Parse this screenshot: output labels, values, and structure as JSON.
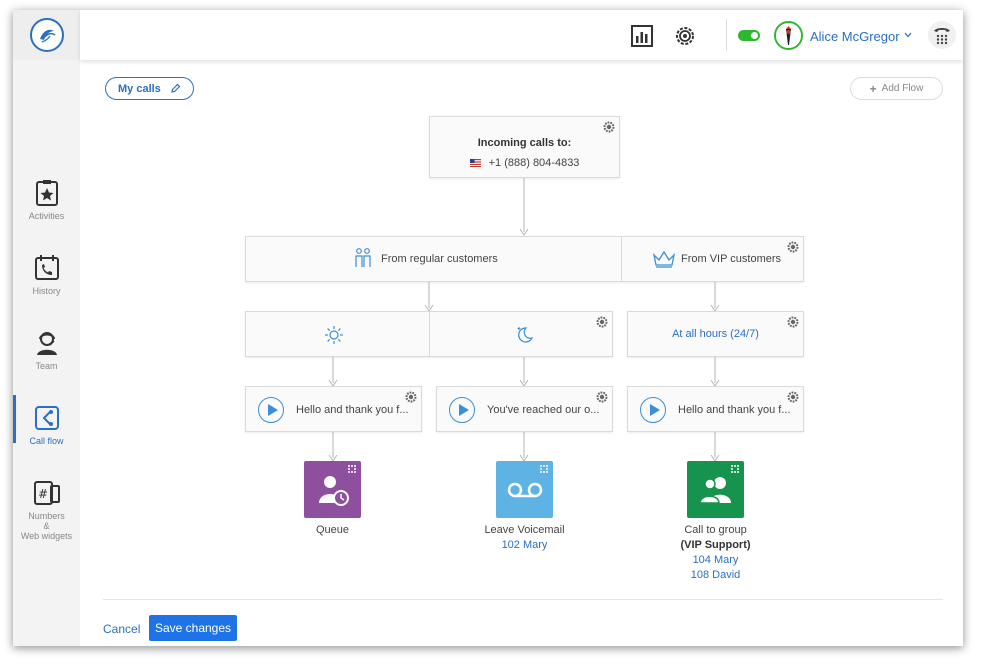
{
  "sidebar": {
    "items": [
      {
        "label": "Activities",
        "icon": "star-clipboard-icon"
      },
      {
        "label": "History",
        "icon": "phone-calendar-icon"
      },
      {
        "label": "Team",
        "icon": "headset-person-icon"
      },
      {
        "label": "Call flow",
        "icon": "call-flow-icon",
        "active": true
      },
      {
        "label": "Numbers\n&\nWeb widgets",
        "icon": "hash-phone-icon"
      }
    ]
  },
  "topbar": {
    "user_name": "Alice McGregor",
    "status": "online"
  },
  "toolbar": {
    "my_calls_label": "My calls",
    "add_flow_label": "Add Flow"
  },
  "flow": {
    "incoming_title": "Incoming calls to:",
    "incoming_number": "+1 (888) 804-4833",
    "regular_label": "From regular customers",
    "vip_label": "From VIP customers",
    "hours_label": "At all hours (24/7)",
    "greetings": [
      "Hello and thank you f...",
      "You've reached our o...",
      "Hello and thank you f..."
    ],
    "destinations": [
      {
        "title": "Queue",
        "color": "#8e4f9e"
      },
      {
        "title": "Leave Voicemail",
        "ext": "102 Mary",
        "color": "#5fb3e4"
      },
      {
        "title": "Call to group",
        "group": "(VIP Support)",
        "members": [
          "104 Mary",
          "108 David"
        ],
        "color": "#16944e"
      }
    ]
  },
  "footer": {
    "cancel_label": "Cancel",
    "save_label": "Save changes"
  },
  "colors": {
    "accent": "#2b6fc0",
    "save_button": "#1e73e8",
    "online": "#2eb82e"
  }
}
